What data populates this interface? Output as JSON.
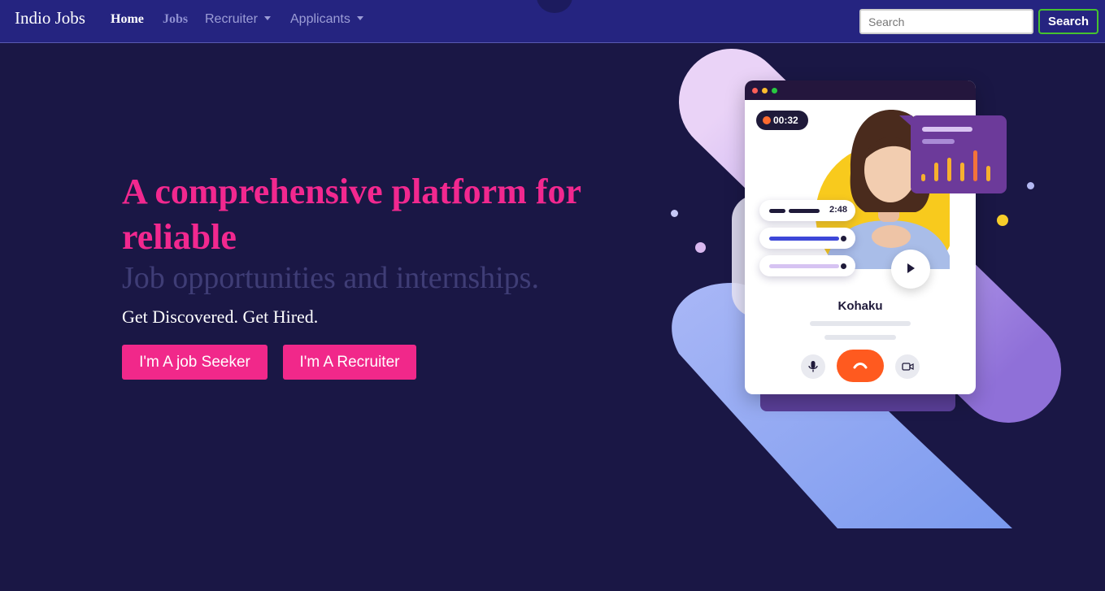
{
  "navbar": {
    "brand": "Indio Jobs",
    "links": {
      "home": "Home",
      "jobs": "Jobs",
      "recruiter": "Recruiter",
      "applicants": "Applicants"
    },
    "search": {
      "placeholder": "Search",
      "button_label": "Search"
    }
  },
  "hero": {
    "headline": "A comprehensive platform for reliable",
    "subline": "Job opportunities and internships.",
    "tagline": "Get Discovered. Get Hired.",
    "cta_seeker": "I'm A job Seeker",
    "cta_recruiter": "I'm A Recruiter"
  },
  "illustration": {
    "timer": "00:32",
    "message_duration": "2:48",
    "caller_name": "Kohaku",
    "icons": [
      "microphone-icon",
      "hang-up-icon",
      "video-camera-icon",
      "play-icon",
      "bar-chart-icon"
    ]
  },
  "colors": {
    "background": "#1a1745",
    "navbar": "#252480",
    "accent_pink": "#f1288a",
    "search_button_border": "#46c22f",
    "hangup_orange": "#ff5a1f"
  }
}
